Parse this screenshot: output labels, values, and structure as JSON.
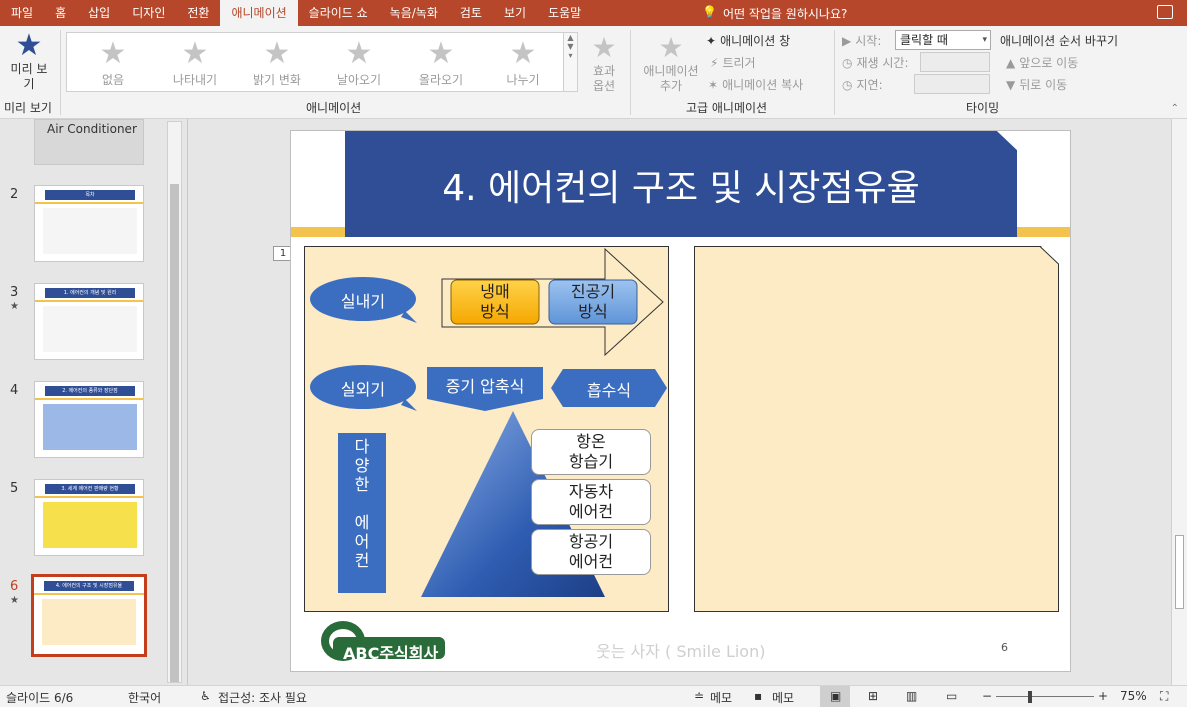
{
  "tabs": [
    "파일",
    "홈",
    "삽입",
    "디자인",
    "전환",
    "애니메이션",
    "슬라이드 쇼",
    "녹음/녹화",
    "검토",
    "보기",
    "도움말"
  ],
  "active_tab": "애니메이션",
  "tell_me": "어떤 작업을 원하시나요?",
  "ribbon": {
    "preview_label": "미리 보기",
    "preview_group": "미리 보기",
    "animations": [
      "없음",
      "나타내기",
      "밝기 변화",
      "날아오기",
      "올라오기",
      "나누기"
    ],
    "effect_options": "효과 옵션",
    "animation_group": "애니메이션",
    "add_animation": "애니메이션 추가",
    "animation_pane": "애니메이션 창",
    "trigger": "트리거",
    "animation_painter": "애니메이션 복사",
    "advanced_group": "고급 애니메이션",
    "start_label": "시작:",
    "start_value": "클릭할 때",
    "duration_label": "재생 시간:",
    "delay_label": "지연:",
    "reorder_label": "애니메이션 순서 바꾸기",
    "move_earlier": "앞으로 이동",
    "move_later": "뒤로 이동",
    "timing_group": "타이밍"
  },
  "thumbnails": [
    {
      "num": "",
      "title": "Air Conditioner",
      "star": false
    },
    {
      "num": "2",
      "title": "목차",
      "star": false
    },
    {
      "num": "3",
      "title": "1. 에어컨의 개념 및 원리",
      "star": true
    },
    {
      "num": "4",
      "title": "2. 에어컨의 종류와 장단점",
      "star": false
    },
    {
      "num": "5",
      "title": "3. 세계 에어컨 판매량 현황",
      "star": false
    },
    {
      "num": "6",
      "title": "4. 에어컨의 구조 및 시장점유율",
      "star": true
    }
  ],
  "slide": {
    "title": "4. 에어컨의 구조 및 시장점유율",
    "anim_marker": "1",
    "indoor": "실내기",
    "outdoor": "실외기",
    "cooling_refrigerant": "냉매\n방식",
    "cooling_vacuum": "진공기\n방식",
    "vapor_compression": "증기 압축식",
    "absorption": "흡수식",
    "various": "다\n양\n한\n\n에\n어\n컨",
    "tile1": "항온\n항습기",
    "tile2": "자동차\n에어컨",
    "tile3": "항공기\n에어컨",
    "logo": "ABC주식회사",
    "footer": "웃는 사자 ( Smile Lion)",
    "page": "6"
  },
  "status": {
    "slide_count": "슬라이드 6/6",
    "language": "한국어",
    "accessibility": "접근성: 조사 필요",
    "notes": "메모",
    "comments": "메모",
    "zoom": "75%"
  }
}
